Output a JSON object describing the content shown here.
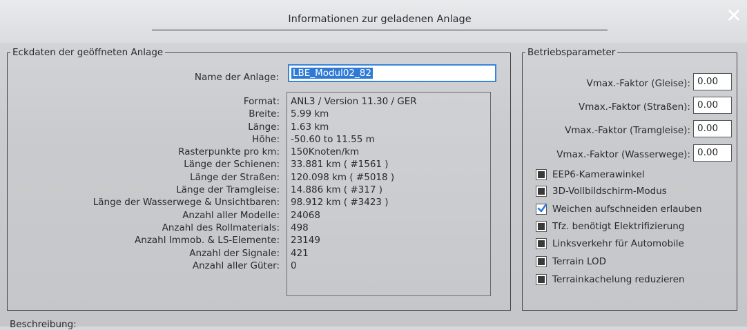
{
  "window": {
    "title": "Informationen zur geladenen Anlage",
    "close_icon": "close-icon"
  },
  "left_group": {
    "legend": "Eckdaten der geöffneten Anlage",
    "name_label": "Name der Anlage:",
    "name_value": "LBE_Modul02_82",
    "rows": [
      {
        "label": "Format:",
        "value": "ANL3 / Version 11.30 / GER"
      },
      {
        "label": "Breite:",
        "value": "5.99 km"
      },
      {
        "label": "Länge:",
        "value": "1.63 km"
      },
      {
        "label": "Höhe:",
        "value": "-50.60 to 11.55 m"
      },
      {
        "label": "Rasterpunkte pro km:",
        "value": "150Knoten/km"
      },
      {
        "label": "Länge der Schienen:",
        "value": "33.881 km ( #1561 )"
      },
      {
        "label": "Länge der Straßen:",
        "value": "120.098 km ( #5018 )"
      },
      {
        "label": "Länge der Tramgleise:",
        "value": "14.886 km ( #317 )"
      },
      {
        "label": "Länge der Wasserwege & Unsichtbaren:",
        "value": "98.912 km ( #3423 )"
      },
      {
        "label": "Anzahl aller Modelle:",
        "value": "24068"
      },
      {
        "label": "Anzahl des Rollmaterials:",
        "value": "498"
      },
      {
        "label": "Anzahl Immob. & LS-Elemente:",
        "value": "23149"
      },
      {
        "label": "Anzahl der Signale:",
        "value": "421"
      },
      {
        "label": "Anzahl aller Güter:",
        "value": "0"
      }
    ]
  },
  "right_group": {
    "legend": "Betriebsparameter",
    "params": [
      {
        "label": "Vmax.-Faktor (Gleise):",
        "value": "0.00"
      },
      {
        "label": "Vmax.-Faktor (Straßen):",
        "value": "0.00"
      },
      {
        "label": "Vmax.-Faktor (Tramgleise):",
        "value": "0.00"
      },
      {
        "label": "Vmax.-Faktor (Wasserwege):",
        "value": "0.00"
      }
    ],
    "options": [
      {
        "label": "EEP6-Kamerawinkel",
        "checked": false
      },
      {
        "label": "3D-Vollbildschirm-Modus",
        "checked": false
      },
      {
        "label": "Weichen aufschneiden erlauben",
        "checked": true
      },
      {
        "label": "Tfz. benötigt Elektrifizierung",
        "checked": false
      },
      {
        "label": "Linksverkehr für Automobile",
        "checked": false
      },
      {
        "label": "Terrain LOD",
        "checked": false
      },
      {
        "label": "Terrainkachelung reduzieren",
        "checked": false
      }
    ]
  },
  "bottom": {
    "label": "Beschreibung:"
  },
  "colors": {
    "accent": "#3a84d8",
    "selection": "#2f7ad6",
    "check_tick": "#2f7ad6"
  }
}
